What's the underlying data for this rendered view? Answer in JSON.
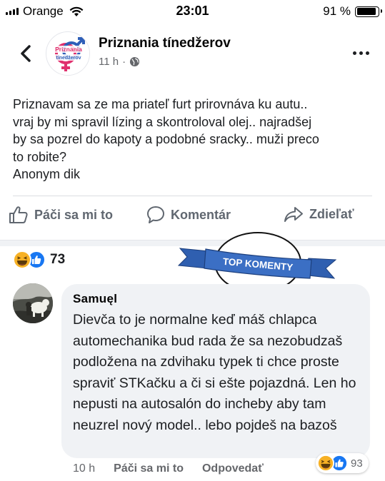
{
  "status_bar": {
    "carrier": "Orange",
    "time": "23:01",
    "battery_text": "91 %",
    "battery_level": 0.91
  },
  "header": {
    "back_icon": "chevron-left-icon",
    "page_name": "Priznania tínedžerov",
    "avatar_text_top": "Priznania",
    "avatar_text_bottom": "tínedžerov",
    "post_age": "11 h",
    "audience_icon": "globe-icon",
    "more_icon": "more-dots-icon"
  },
  "post": {
    "text": "Priznavam sa ze ma priateľ furt prirovnáva ku autu..\nvraj by mi spravil lízing a skontroloval olej.. najradšej\nby sa pozrel do kapoty a podobné sracky.. muži preco\nto robite?\nAnonym dik"
  },
  "actions": {
    "like_label": "Páči sa mi to",
    "comment_label": "Komentár",
    "share_label": "Zdieľať"
  },
  "reactions": {
    "icons": [
      "haha-icon",
      "like-icon"
    ],
    "count": "73"
  },
  "banner": {
    "label": "TOP KOMENTY",
    "color": "#3b6fc4"
  },
  "comment": {
    "author": "Samuęl",
    "text": "Dievča to je normalne keď máš chlapca automechanika bud rada že sa nezobudzaš podložena na zdvihaku typek ti chce proste spraviť STKačku a či si ešte pojazdná. Len ho nepusti na autosalón do incheby aby tam neuzrel nový model.. lebo pojdeš na bazoš",
    "time": "10 h",
    "like_label": "Páči sa mi to",
    "reply_label": "Odpovedať",
    "reaction_count": "93"
  },
  "colors": {
    "facebook_blue": "#1877f2",
    "haha_yellow": "#f7b125",
    "muted": "#65676b"
  }
}
